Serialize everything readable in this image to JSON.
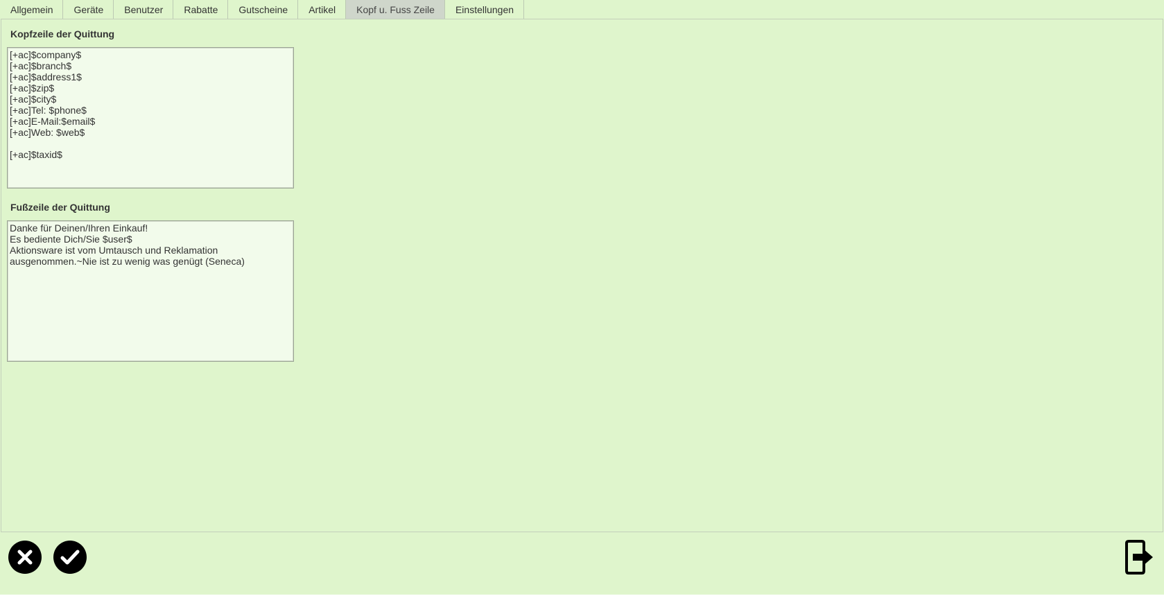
{
  "tabs": [
    {
      "label": "Allgemein"
    },
    {
      "label": "Geräte"
    },
    {
      "label": "Benutzer"
    },
    {
      "label": "Rabatte"
    },
    {
      "label": "Gutscheine"
    },
    {
      "label": "Artikel"
    },
    {
      "label": "Kopf u. Fuss Zeile",
      "active": true
    },
    {
      "label": "Einstellungen"
    }
  ],
  "header_section": {
    "label": "Kopfzeile der Quittung",
    "value": "[+ac]$company$\n[+ac]$branch$\n[+ac]$address1$\n[+ac]$zip$\n[+ac]$city$\n[+ac]Tel: $phone$\n[+ac]E-Mail:$email$\n[+ac]Web: $web$\n\n[+ac]$taxid$"
  },
  "footer_section": {
    "label": "Fußzeile der Quittung",
    "value": "Danke für Deinen/Ihren Einkauf!\nEs bediente Dich/Sie $user$\nAktionsware ist vom Umtausch und Reklamation\nausgenommen.~Nie ist zu wenig was genügt (Seneca)"
  },
  "toolbar": {
    "cancel_icon": "close-icon",
    "confirm_icon": "checkmark-icon",
    "exit_icon": "exit-icon"
  },
  "colors": {
    "background": "#dff5cc",
    "active_tab": "#cfd6cb",
    "textbox_bg": "#f2fbeb",
    "button": "#000000"
  }
}
